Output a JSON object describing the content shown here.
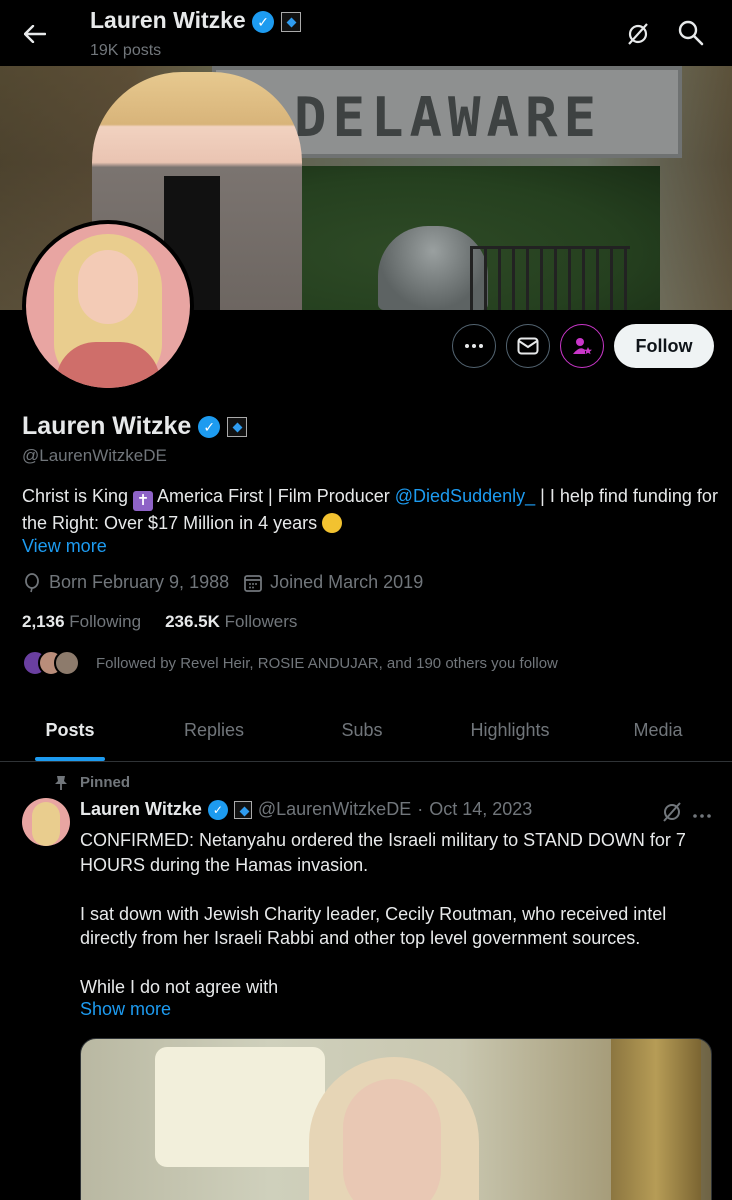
{
  "header": {
    "display_name": "Lauren Witzke",
    "post_count": "19K posts"
  },
  "banner": {
    "sign_text": "DELAWARE"
  },
  "profile": {
    "display_name": "Lauren Witzke",
    "handle": "@LaurenWitzkeDE",
    "bio_part1": "Christ is King ",
    "bio_part2": " America First | Film Producer ",
    "bio_mention": "@DiedSuddenly_",
    "bio_part3": " | I help find funding for the Right: Over $17 Million in 4 years ",
    "view_more": "View more",
    "born": "Born February 9, 1988",
    "joined": "Joined March 2019",
    "following_count": "2,136",
    "following_label": "Following",
    "followers_count": "236.5K",
    "followers_label": "Followers",
    "followed_by": "Followed by Revel Heir, ROSIE ANDUJAR, and 190 others you follow"
  },
  "actions": {
    "follow_label": "Follow"
  },
  "tabs": [
    {
      "label": "Posts"
    },
    {
      "label": "Replies"
    },
    {
      "label": "Subs"
    },
    {
      "label": "Highlights"
    },
    {
      "label": "Media"
    }
  ],
  "post": {
    "pinned_label": "Pinned",
    "author_name": "Lauren Witzke",
    "author_handle": "@LaurenWitzkeDE",
    "dot": "·",
    "date": "Oct 14, 2023",
    "para1": "CONFIRMED: Netanyahu ordered the Israeli military to STAND DOWN for 7 HOURS during the Hamas invasion.",
    "para2": "I sat down with Jewish Charity leader, Cecily Routman, who received intel directly from her Israeli Rabbi and other top level government sources.",
    "para3": "While I do not agree with",
    "show_more": "Show more"
  },
  "colors": {
    "accent": "#1d9bf0",
    "muted": "#71767b",
    "subscribe": "#c936c9"
  },
  "icons": [
    "back-arrow-icon",
    "grok-icon",
    "search-icon",
    "more-icon",
    "message-icon",
    "subscribe-icon",
    "location-icon",
    "calendar-icon",
    "pin-icon",
    "verified-icon"
  ]
}
